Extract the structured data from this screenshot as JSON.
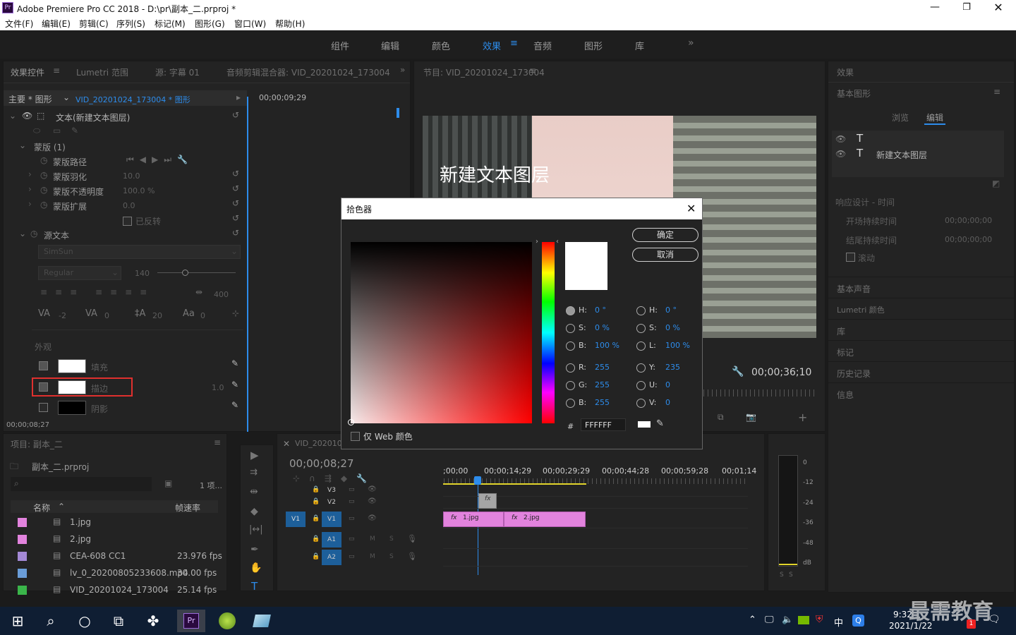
{
  "window": {
    "app_icon": "Pr",
    "title": "Adobe Premiere Pro CC 2018 - D:\\pr\\副本_二.prproj *"
  },
  "menu": [
    "文件(F)",
    "编辑(E)",
    "剪辑(C)",
    "序列(S)",
    "标记(M)",
    "图形(G)",
    "窗口(W)",
    "帮助(H)"
  ],
  "workspaces": [
    "组件",
    "编辑",
    "颜色",
    "效果",
    "音频",
    "图形",
    "库"
  ],
  "workspaces_more": "»",
  "effect_controls": {
    "tabs": [
      "效果控件",
      "Lumetri 范围",
      "源: 字幕 01",
      "音频剪辑混合器: VID_20201024_173004"
    ],
    "master": "主要 * 图形",
    "clip": "VID_20201024_173004 * 图形",
    "timecode": "00;00;09;29",
    "layer": "文本(新建文本图层)",
    "mask": "蒙版 (1)",
    "mask_path": "蒙版路径",
    "mask_feather": "蒙版羽化",
    "mask_feather_val": "10.0",
    "mask_opacity": "蒙版不透明度",
    "mask_opacity_val": "100.0 %",
    "mask_expand": "蒙版扩展",
    "mask_expand_val": "0.0",
    "inverted": "已反转",
    "source_text": "源文本",
    "font": "SimSun",
    "style": "Regular",
    "font_size": "140",
    "tracking_val": "400",
    "kern_vals": [
      "-2",
      "0",
      "20",
      "0"
    ],
    "appearance": "外观",
    "fill": "填充",
    "stroke": "描边",
    "stroke_width": "1.0",
    "shadow": "阴影",
    "bottom_timecode": "00;00;08;27"
  },
  "program": {
    "tab": "节目: VID_20201024_173004",
    "overlay_text": "新建文本图层",
    "timecode": "00;00;36;10"
  },
  "right_panel": {
    "effects": "效果",
    "essential_graphics": "基本图形",
    "browse": "浏览",
    "edit": "编辑",
    "layer_name": "新建文本图层",
    "responsive": "响应设计 - 时间",
    "intro": "开场持续时间",
    "intro_val": "00;00;00;00",
    "outro": "结尾持续时间",
    "outro_val": "00;00;00;00",
    "roll": "滚动",
    "sections": [
      "基本声音",
      "Lumetri 颜色",
      "库",
      "标记",
      "历史记录",
      "信息"
    ]
  },
  "project": {
    "tab": "项目: 副本_二",
    "file": "副本_二.prproj",
    "count": "1 项...",
    "col_name": "名称",
    "col_fps": "帧速率",
    "items": [
      {
        "name": "1.jpg",
        "fps": "",
        "color": "#e283dd"
      },
      {
        "name": "2.jpg",
        "fps": "",
        "color": "#e283dd"
      },
      {
        "name": "CEA-608 CC1",
        "fps": "23.976 fps",
        "color": "#a489d6"
      },
      {
        "name": "lv_0_20200805233608.mp4",
        "fps": "30.00 fps",
        "color": "#6a9dd8"
      },
      {
        "name": "VID_20201024_173004",
        "fps": "25.14 fps",
        "color": "#3ab54a"
      }
    ]
  },
  "timeline": {
    "tab": "VID_202010",
    "timecode": "00;00;08;27",
    "ruler": [
      ";00;00",
      "00;00;14;29",
      "00;00;29;29",
      "00;00;44;28",
      "00;00;59;28",
      "00;01;14"
    ],
    "tracks": [
      "V3",
      "V2",
      "V1",
      "A1",
      "A2"
    ],
    "v1_src": "V1",
    "clip1": "1.jpg",
    "clip2": "2.jpg",
    "fx": "fx",
    "meter_labels": [
      "0",
      "-12",
      "-24",
      "-36",
      "-48",
      "dB"
    ],
    "meter_solo": [
      "S",
      "S"
    ]
  },
  "color_picker": {
    "title": "拾色器",
    "ok": "确定",
    "cancel": "取消",
    "web_only": "仅 Web 颜色",
    "hex_label": "#",
    "hex": "FFFFFF",
    "fields_left": [
      {
        "label": "H:",
        "value": "0 °",
        "on": true
      },
      {
        "label": "S:",
        "value": "0 %",
        "on": false
      },
      {
        "label": "B:",
        "value": "100 %",
        "on": false
      },
      {
        "label": "R:",
        "value": "255",
        "on": false
      },
      {
        "label": "G:",
        "value": "255",
        "on": false
      },
      {
        "label": "B:",
        "value": "255",
        "on": false
      }
    ],
    "fields_right": [
      {
        "label": "H:",
        "value": "0 °"
      },
      {
        "label": "S:",
        "value": "0 %"
      },
      {
        "label": "L:",
        "value": "100 %"
      },
      {
        "label": "Y:",
        "value": "235"
      },
      {
        "label": "U:",
        "value": "0"
      },
      {
        "label": "V:",
        "value": "0"
      }
    ]
  },
  "taskbar": {
    "time": "9:32",
    "date": "2021/1/22",
    "ime": "中",
    "notif": "1",
    "watermark": "最需教育"
  }
}
